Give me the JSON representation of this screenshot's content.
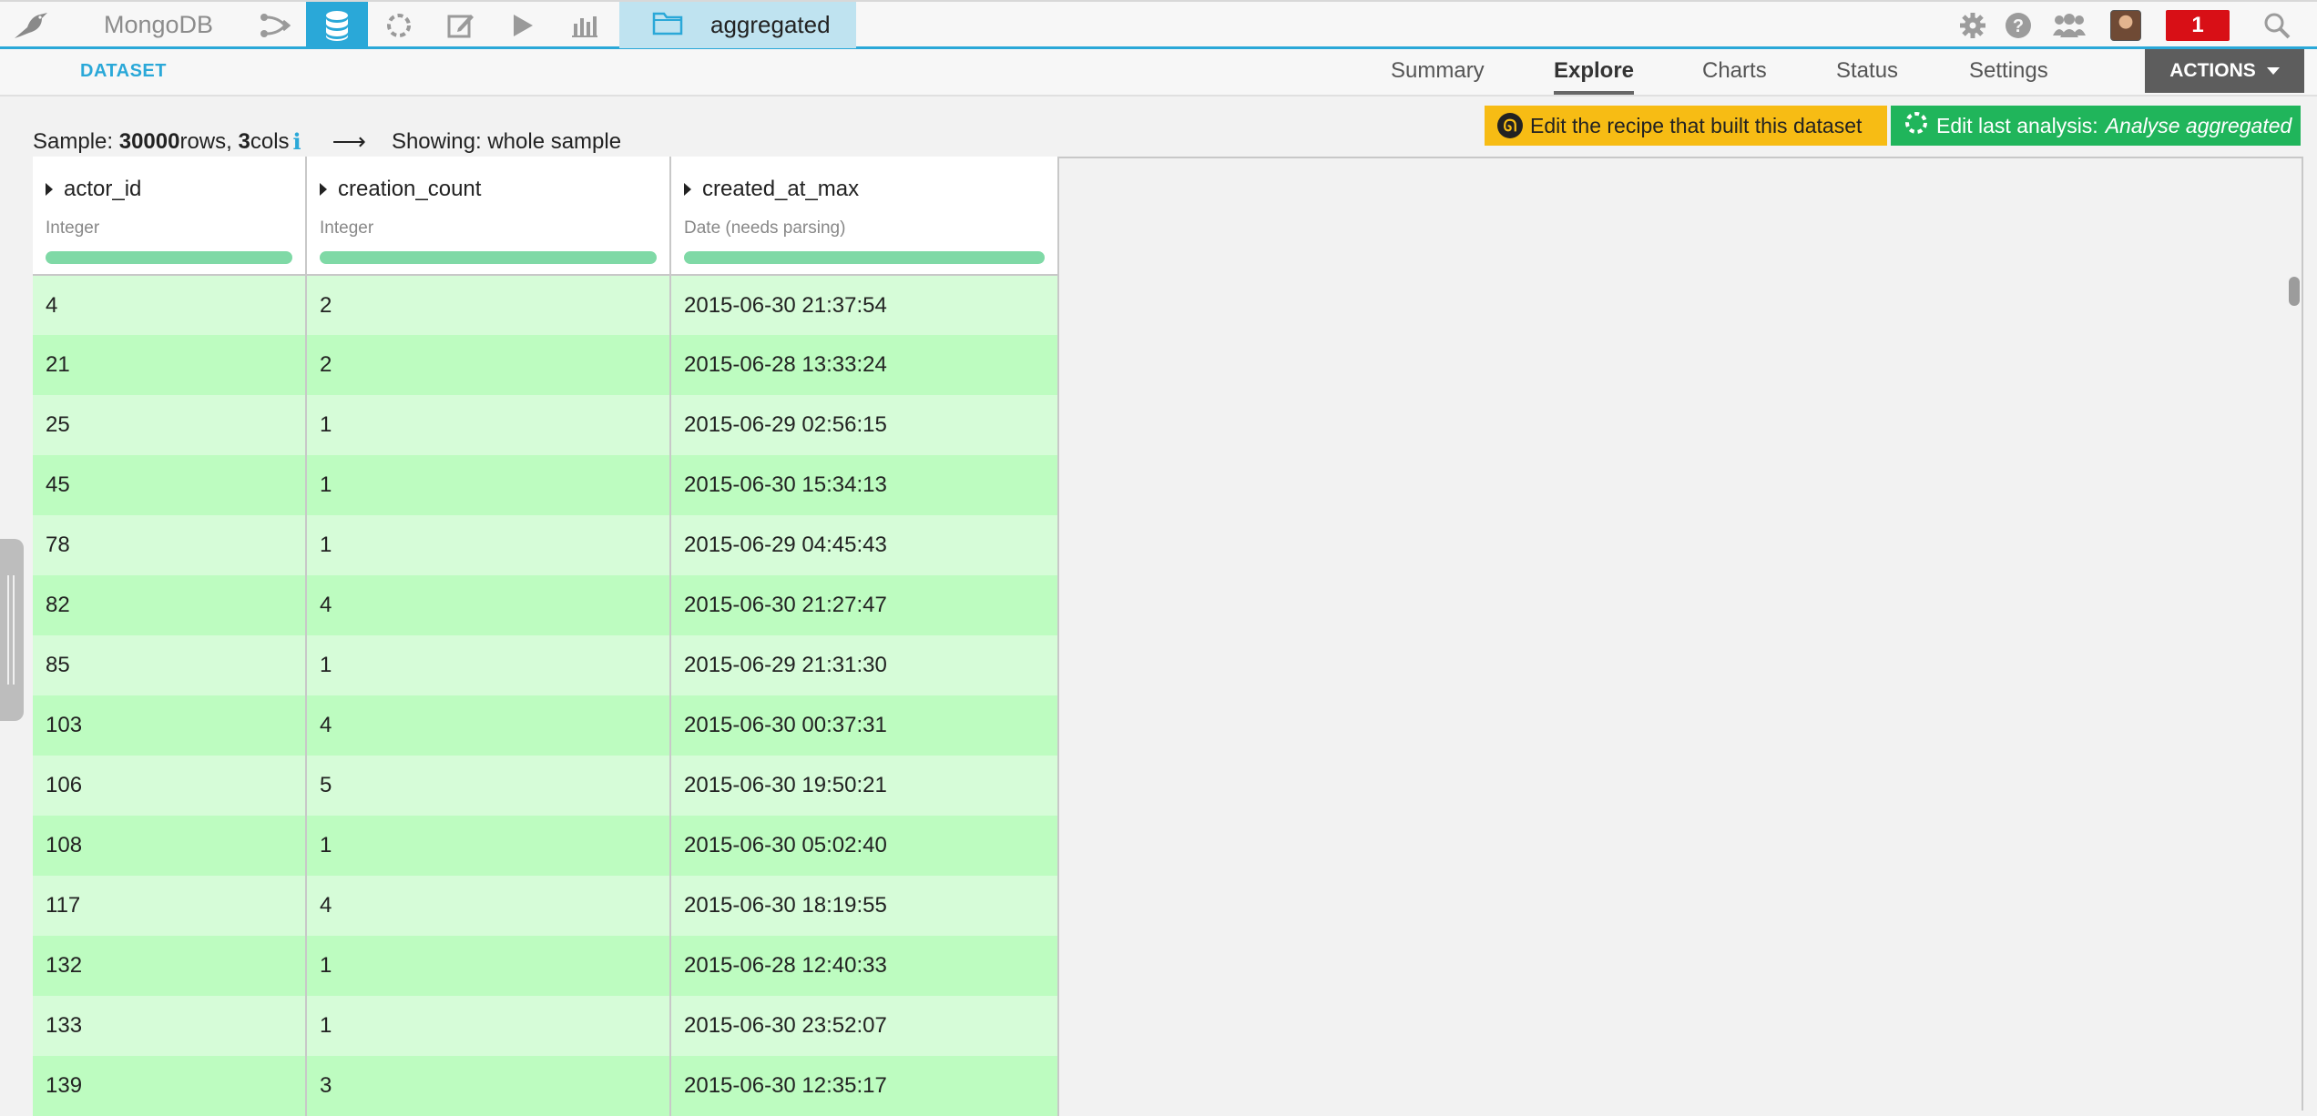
{
  "topbar": {
    "project_name": "MongoDB",
    "crumb_label": "aggregated",
    "notifications": "1",
    "nav_icons": [
      "flow-icon",
      "datasets-icon",
      "analysis-icon",
      "notebook-icon",
      "jobs-icon",
      "dashboard-icon"
    ],
    "right_icons": [
      "gear-icon",
      "help-icon",
      "people-icon",
      "avatar",
      "notifications-badge",
      "search-icon"
    ]
  },
  "subbar": {
    "dataset_tag": "DATASET",
    "tabs": [
      "Summary",
      "Explore",
      "Charts",
      "Status",
      "Settings"
    ],
    "active_tab": "Explore",
    "actions_label": "ACTIONS"
  },
  "sample": {
    "prefix": "Sample: ",
    "rows": "30000",
    "rows_suffix": " rows, ",
    "cols": "3",
    "cols_suffix": " cols",
    "info": "i",
    "showing": "Showing: whole sample"
  },
  "buttons": {
    "recipe_label": "Edit the recipe that built this dataset",
    "analysis_prefix": "Edit last analysis: ",
    "analysis_name": "Analyse aggregated"
  },
  "table": {
    "columns": [
      {
        "name": "actor_id",
        "type": "Integer"
      },
      {
        "name": "creation_count",
        "type": "Integer"
      },
      {
        "name": "created_at_max",
        "type": "Date (needs parsing)"
      }
    ],
    "rows": [
      [
        "4",
        "2",
        "2015-06-30 21:37:54"
      ],
      [
        "21",
        "2",
        "2015-06-28 13:33:24"
      ],
      [
        "25",
        "1",
        "2015-06-29 02:56:15"
      ],
      [
        "45",
        "1",
        "2015-06-30 15:34:13"
      ],
      [
        "78",
        "1",
        "2015-06-29 04:45:43"
      ],
      [
        "82",
        "4",
        "2015-06-30 21:27:47"
      ],
      [
        "85",
        "1",
        "2015-06-29 21:31:30"
      ],
      [
        "103",
        "4",
        "2015-06-30 00:37:31"
      ],
      [
        "106",
        "5",
        "2015-06-30 19:50:21"
      ],
      [
        "108",
        "1",
        "2015-06-30 05:02:40"
      ],
      [
        "117",
        "4",
        "2015-06-30 18:19:55"
      ],
      [
        "132",
        "1",
        "2015-06-28 12:40:33"
      ],
      [
        "133",
        "1",
        "2015-06-30 23:52:07"
      ],
      [
        "139",
        "3",
        "2015-06-30 12:35:17"
      ]
    ]
  }
}
